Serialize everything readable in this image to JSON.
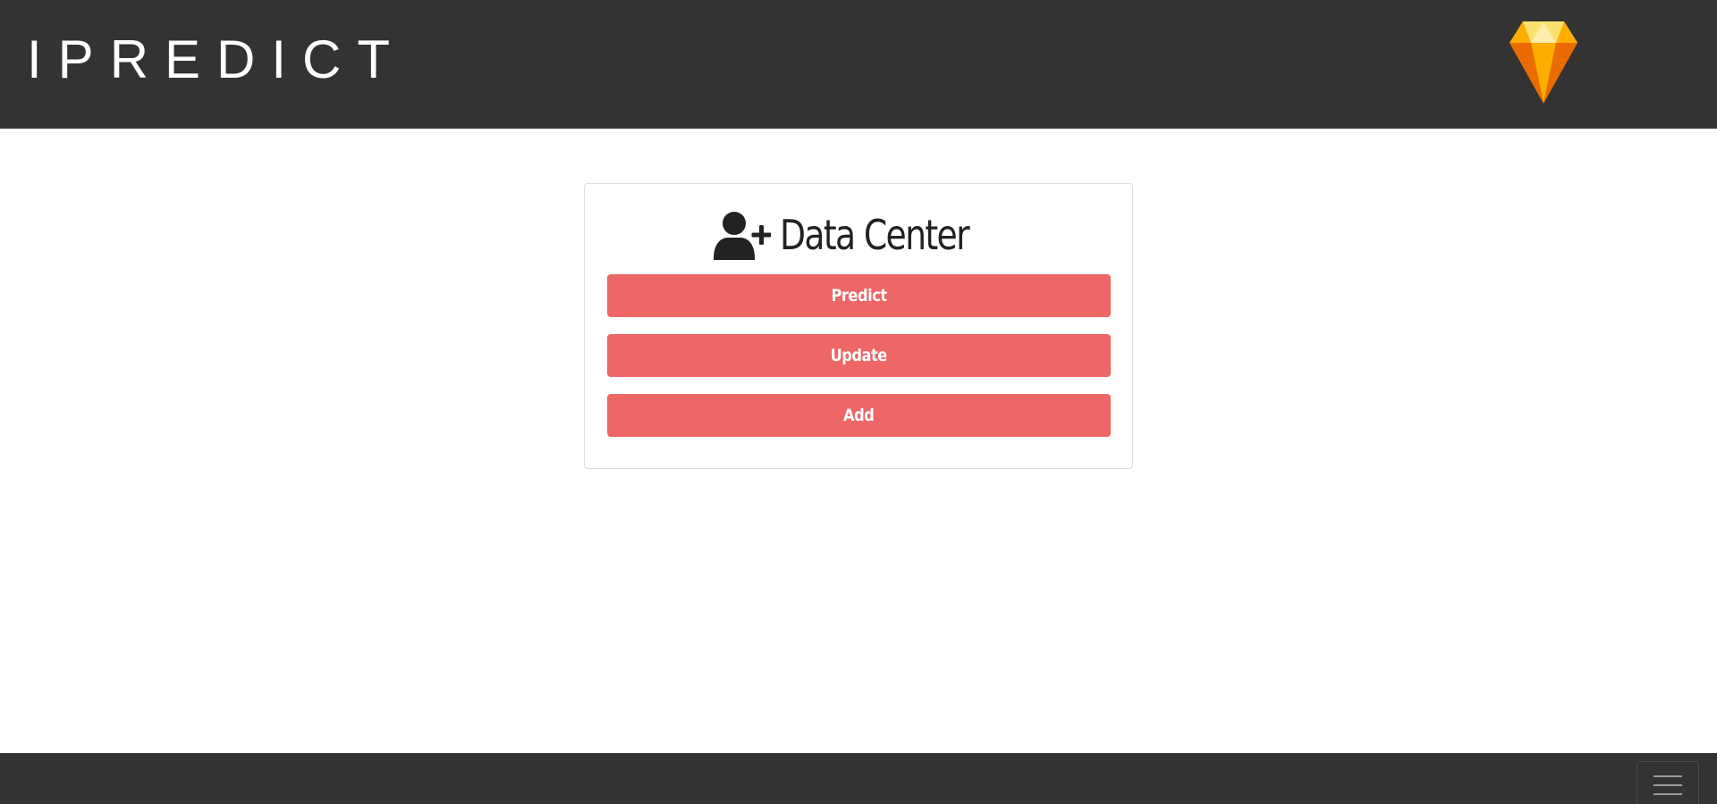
{
  "header": {
    "brand_title": "IPREDICT",
    "logo_icon": "sketch-diamond-icon"
  },
  "card": {
    "title": "Data Center",
    "title_icon": "user-plus-icon",
    "buttons": [
      {
        "label": "Predict"
      },
      {
        "label": "Update"
      },
      {
        "label": "Add"
      }
    ]
  },
  "footer": {
    "menu_icon": "hamburger-icon"
  },
  "colors": {
    "bar_background": "#333333",
    "button_background": "#ec6766",
    "button_text": "#ffffff",
    "title_text": "#222222",
    "page_background": "#ffffff"
  }
}
